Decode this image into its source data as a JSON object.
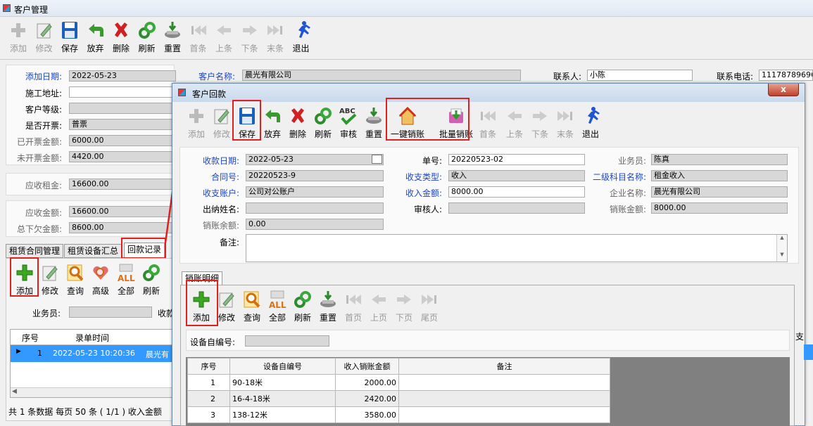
{
  "main": {
    "title": "客户管理",
    "toolbar": [
      {
        "label": "添加",
        "icon": "plus-icon",
        "enabled": false
      },
      {
        "label": "修改",
        "icon": "edit-icon",
        "enabled": false
      },
      {
        "label": "保存",
        "icon": "floppy-disk-icon",
        "enabled": true
      },
      {
        "label": "放弃",
        "icon": "undo-arrow-icon",
        "enabled": true
      },
      {
        "label": "删除",
        "icon": "red-x-icon",
        "enabled": true
      },
      {
        "label": "刷新",
        "icon": "refresh-icon",
        "enabled": true
      },
      {
        "label": "重置",
        "icon": "reset-icon",
        "enabled": true
      },
      {
        "label": "首条",
        "icon": "first-record-icon",
        "enabled": false
      },
      {
        "label": "上条",
        "icon": "prev-record-icon",
        "enabled": false
      },
      {
        "label": "下条",
        "icon": "next-record-icon",
        "enabled": false
      },
      {
        "label": "末条",
        "icon": "last-record-icon",
        "enabled": false
      },
      {
        "label": "退出",
        "icon": "running-man-icon",
        "enabled": true
      }
    ],
    "form": {
      "add_date_label": "添加日期:",
      "add_date": "2022-05-23",
      "address_label": "施工地址:",
      "address": "",
      "level_label": "客户等级:",
      "level": "",
      "invoice_label": "是否开票:",
      "invoice": "普票",
      "invoiced_label": "已开票金额:",
      "invoiced": "6000.00",
      "uninvoiced_label": "未开票金额:",
      "uninvoiced": "4420.00",
      "rent_label": "应收租金:",
      "rent": "16600.00",
      "receivable_label": "应收金额:",
      "receivable": "16600.00",
      "owed_label": "总下欠金额:",
      "owed": "8600.00",
      "customer_name_label": "客户名称:",
      "customer_name": "晨光有限公司",
      "contact_label": "联系人:",
      "contact": "小陈",
      "phone_label": "联系电话:",
      "phone": "11178789696"
    },
    "tabs": [
      "租赁合同管理",
      "租赁设备汇总",
      "回款记录"
    ],
    "sub_toolbar": [
      {
        "label": "添加",
        "icon": "green-plus-icon"
      },
      {
        "label": "修改",
        "icon": "edit-icon"
      },
      {
        "label": "查询",
        "icon": "magnifier-icon"
      },
      {
        "label": "高级",
        "icon": "heart-search-icon"
      },
      {
        "label": "全部",
        "icon": "all-icon"
      },
      {
        "label": "刷新",
        "icon": "refresh-icon"
      }
    ],
    "salesman_label": "业务员:",
    "collect_label": "收款",
    "list_headers": [
      "序号",
      "录单时间"
    ],
    "list_row": {
      "no": "1",
      "time": "2022-05-23 10:20:36",
      "customer": "晨光有"
    },
    "status": "共 1 条数据  每页 50 条 ( 1/1 )  收入金额"
  },
  "dialog": {
    "title": "客户回款",
    "close_label": "x",
    "toolbar": [
      {
        "label": "添加",
        "icon": "plus-icon",
        "enabled": false
      },
      {
        "label": "修改",
        "icon": "edit-icon",
        "enabled": false
      },
      {
        "label": "保存",
        "icon": "floppy-disk-icon",
        "enabled": true
      },
      {
        "label": "放弃",
        "icon": "undo-arrow-icon",
        "enabled": true
      },
      {
        "label": "删除",
        "icon": "red-x-icon",
        "enabled": true
      },
      {
        "label": "刷新",
        "icon": "refresh-icon",
        "enabled": true
      },
      {
        "label": "审核",
        "icon": "abc-check-icon",
        "enabled": true
      },
      {
        "label": "重置",
        "icon": "reset-icon",
        "enabled": true
      },
      {
        "label": "一键销账",
        "icon": "house-icon",
        "enabled": true
      },
      {
        "label": "批量销账",
        "icon": "batch-icon",
        "enabled": true
      },
      {
        "label": "首条",
        "icon": "first-record-icon",
        "enabled": false
      },
      {
        "label": "上条",
        "icon": "prev-record-icon",
        "enabled": false
      },
      {
        "label": "下条",
        "icon": "next-record-icon",
        "enabled": false
      },
      {
        "label": "末条",
        "icon": "last-record-icon",
        "enabled": false
      },
      {
        "label": "退出",
        "icon": "running-man-icon",
        "enabled": true
      }
    ],
    "form": {
      "date_label": "收款日期:",
      "date": "2022-05-23",
      "order_label": "单号:",
      "order": "20220523-02",
      "salesman_label": "业务员:",
      "salesman": "陈真",
      "contract_label": "合同号:",
      "contract": "20220523-9",
      "type_label": "收支类型:",
      "type": "收入",
      "subject_label": "二级科目名称:",
      "subject": "租金收入",
      "account_label": "收支账户:",
      "account": "公司对公账户",
      "amount_label": "收入金额:",
      "amount": "8000.00",
      "company_label": "企业名称:",
      "company": "晨光有限公司",
      "cashier_label": "出纳姓名:",
      "cashier": "",
      "auditor_label": "审核人:",
      "auditor": "",
      "writeoff_label": "销账金额:",
      "writeoff": "8000.00",
      "balance_label": "销账余额:",
      "balance": "0.00",
      "remark_label": "备注:",
      "remark": ""
    },
    "detail_tab": "销账明细",
    "detail_toolbar": [
      {
        "label": "添加",
        "icon": "green-plus-icon",
        "enabled": true
      },
      {
        "label": "修改",
        "icon": "edit-icon",
        "enabled": true
      },
      {
        "label": "查询",
        "icon": "magnifier-icon",
        "enabled": true
      },
      {
        "label": "全部",
        "icon": "all-icon",
        "enabled": true
      },
      {
        "label": "刷新",
        "icon": "refresh-icon",
        "enabled": true
      },
      {
        "label": "重置",
        "icon": "reset-icon",
        "enabled": true
      },
      {
        "label": "首页",
        "icon": "first-page-icon",
        "enabled": false
      },
      {
        "label": "上页",
        "icon": "prev-page-icon",
        "enabled": false
      },
      {
        "label": "下页",
        "icon": "next-page-icon",
        "enabled": false
      },
      {
        "label": "尾页",
        "icon": "last-page-icon",
        "enabled": false
      }
    ],
    "device_label": "设备自编号:",
    "headers": [
      "序号",
      "设备自编号",
      "收入销账金额",
      "备注"
    ],
    "rows": [
      {
        "no": "1",
        "device": "90-18米",
        "amount": "2000.00",
        "remark": ""
      },
      {
        "no": "2",
        "device": "16-4-18米",
        "amount": "2420.00",
        "remark": ""
      },
      {
        "no": "3",
        "device": "138-12米",
        "amount": "3580.00",
        "remark": ""
      }
    ],
    "right_edge_label": "支"
  },
  "colors": {
    "highlight": "#e02020",
    "label_blue": "#1e46c8",
    "row_selected": "#3399ff"
  }
}
